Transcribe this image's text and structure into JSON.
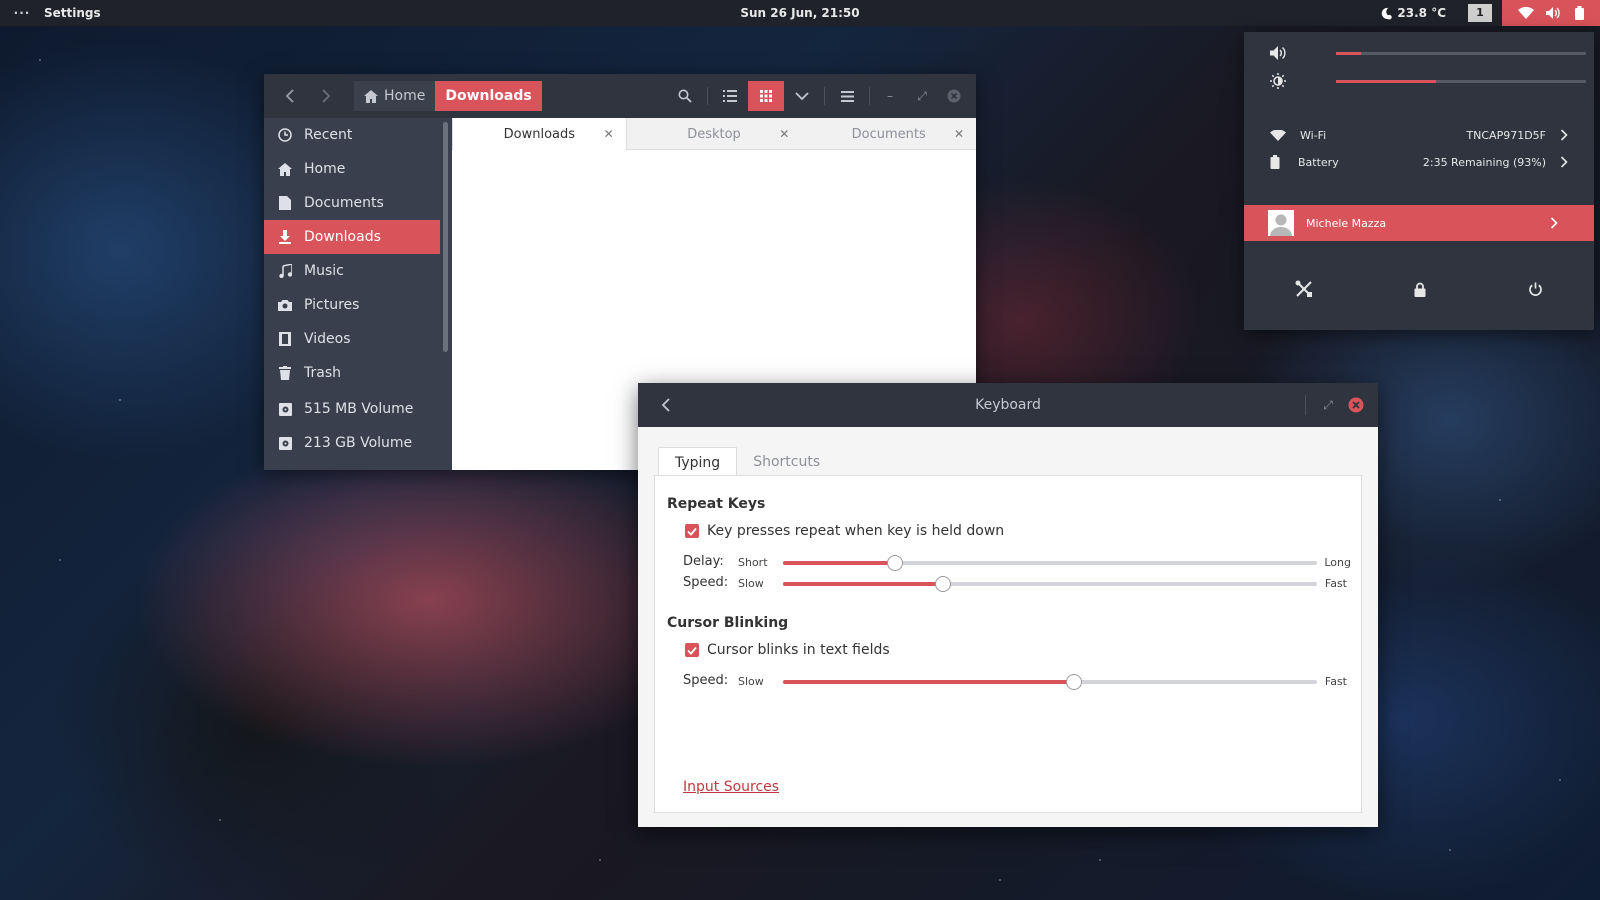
{
  "topbar": {
    "app_name": "Settings",
    "clock": "Sun 26 Jun, 21:50",
    "weather": "23.8 °C",
    "workspace": "1"
  },
  "file_manager": {
    "breadcrumbs": [
      "Home",
      "Downloads"
    ],
    "sidebar": [
      {
        "label": "Recent",
        "icon": "clock-icon"
      },
      {
        "label": "Home",
        "icon": "home-icon"
      },
      {
        "label": "Documents",
        "icon": "document-icon"
      },
      {
        "label": "Downloads",
        "icon": "download-icon",
        "active": true
      },
      {
        "label": "Music",
        "icon": "music-icon"
      },
      {
        "label": "Pictures",
        "icon": "camera-icon"
      },
      {
        "label": "Videos",
        "icon": "film-icon"
      },
      {
        "label": "Trash",
        "icon": "trash-icon"
      },
      {
        "label": "515 MB Volume",
        "icon": "drive-icon"
      },
      {
        "label": "213 GB Volume",
        "icon": "drive-icon"
      }
    ],
    "tabs": [
      {
        "label": "Downloads",
        "active": true
      },
      {
        "label": "Desktop",
        "active": false
      },
      {
        "label": "Documents",
        "active": false
      }
    ]
  },
  "quick_settings": {
    "volume_level": 0.1,
    "brightness_level": 0.4,
    "wifi": {
      "label": "Wi-Fi",
      "value": "TNCAP971D5F"
    },
    "battery": {
      "label": "Battery",
      "value": "2:35 Remaining (93%)"
    },
    "user": "Michele Mazza"
  },
  "keyboard": {
    "title": "Keyboard",
    "tabs": [
      "Typing",
      "Shortcuts"
    ],
    "repeat_keys": {
      "title": "Repeat Keys",
      "checkbox": "Key presses repeat when key is held down",
      "delay": {
        "label": "Delay:",
        "min": "Short",
        "max": "Long",
        "value": 0.21
      },
      "speed": {
        "label": "Speed:",
        "min": "Slow",
        "max": "Fast",
        "value": 0.3
      }
    },
    "cursor_blinking": {
      "title": "Cursor Blinking",
      "checkbox": "Cursor blinks in text fields",
      "speed": {
        "label": "Speed:",
        "min": "Slow",
        "max": "Fast",
        "value": 0.545
      }
    },
    "input_sources": "Input Sources"
  },
  "colors": {
    "accent": "#d9535a",
    "header": "#2f343f",
    "sidebar": "#393f4c"
  }
}
